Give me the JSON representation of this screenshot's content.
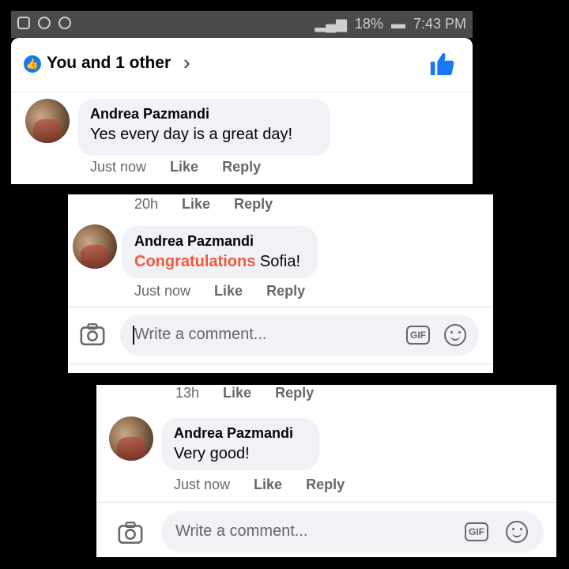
{
  "status_bar": {
    "battery": "18%",
    "time": "7:43 PM"
  },
  "header": {
    "likes_text": "You and 1 other",
    "chevron": "›"
  },
  "colors": {
    "accent": "#1877f2",
    "highlight": "#f0593e",
    "bubble": "#f0f2f5"
  },
  "panel1": {
    "comment": {
      "author": "Andrea Pazmandi",
      "text": "Yes every day is a great day!"
    },
    "meta": {
      "time": "Just now",
      "like": "Like",
      "reply": "Reply"
    }
  },
  "panel2": {
    "prev_meta": {
      "time": "20h",
      "like": "Like",
      "reply": "Reply"
    },
    "comment": {
      "author": "Andrea Pazmandi",
      "highlight": "Congratulations",
      "text_rest": " Sofia!"
    },
    "meta": {
      "time": "Just now",
      "like": "Like",
      "reply": "Reply"
    },
    "composer": {
      "placeholder": "Write a comment...",
      "gif": "GIF"
    }
  },
  "panel3": {
    "prev_meta": {
      "time": "13h",
      "like": "Like",
      "reply": "Reply"
    },
    "comment": {
      "author": "Andrea Pazmandi",
      "text": "Very good!"
    },
    "meta": {
      "time": "Just now",
      "like": "Like",
      "reply": "Reply"
    },
    "composer": {
      "placeholder": "Write a comment...",
      "gif": "GIF"
    }
  }
}
